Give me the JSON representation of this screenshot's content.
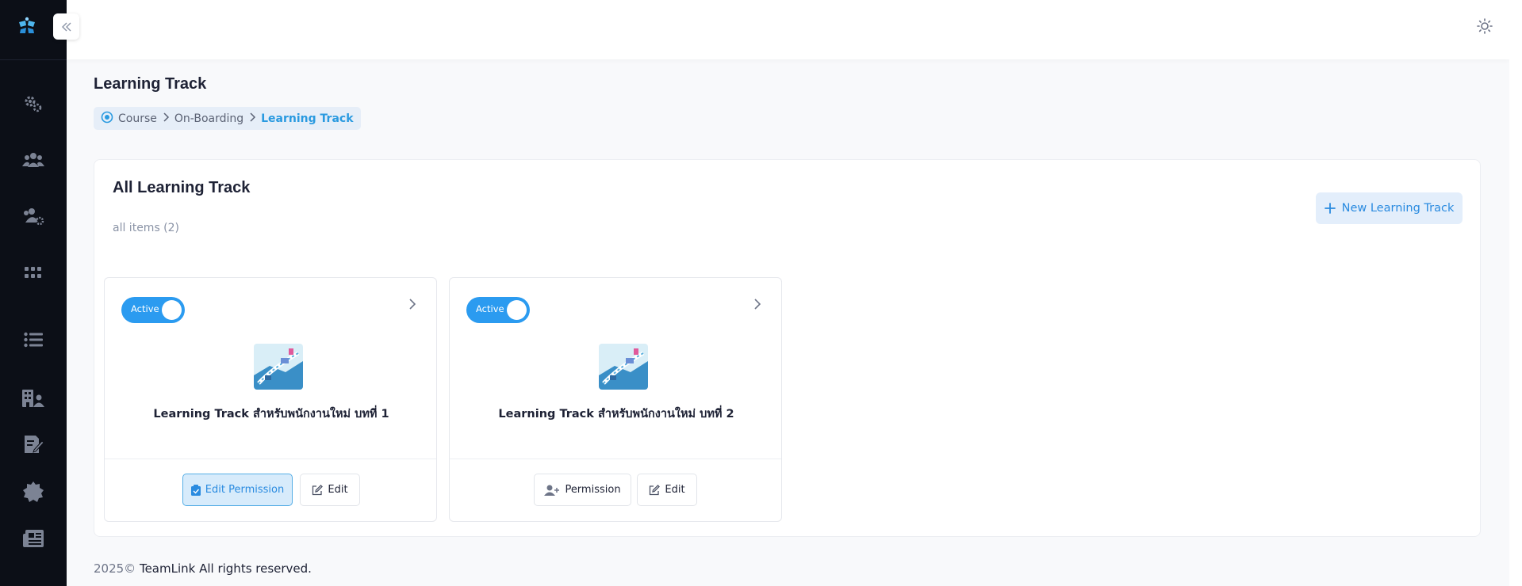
{
  "header": {
    "page_title": "Learning Track"
  },
  "breadcrumb": {
    "items": [
      "Course",
      "On-Boarding",
      "Learning Track"
    ]
  },
  "sidebar": {
    "icons": [
      "settings-gears-icon",
      "users-icon",
      "user-group-settings-icon",
      "apps-grid-icon",
      "list-icon",
      "building-icon",
      "document-edit-icon",
      "badge-icon",
      "newspaper-icon"
    ]
  },
  "main": {
    "title": "All Learning Track",
    "count": "all items (2)",
    "new_button_label": "New Learning Track"
  },
  "tracks": [
    {
      "status": "Active",
      "name": "Learning Track สำหรับพนักงานใหม่ บทที่ 1",
      "primary_button": "Edit Permission",
      "edit_button": "Edit"
    },
    {
      "status": "Active",
      "name": "Learning Track สำหรับพนักงานใหม่ บทที่ 2",
      "primary_button": "Permission",
      "edit_button": "Edit"
    }
  ],
  "footer": {
    "year": "2025©",
    "text": " TeamLink All rights reserved."
  },
  "colors": {
    "accent": "#2b9bf0",
    "sidebar": "#0c0f17"
  }
}
